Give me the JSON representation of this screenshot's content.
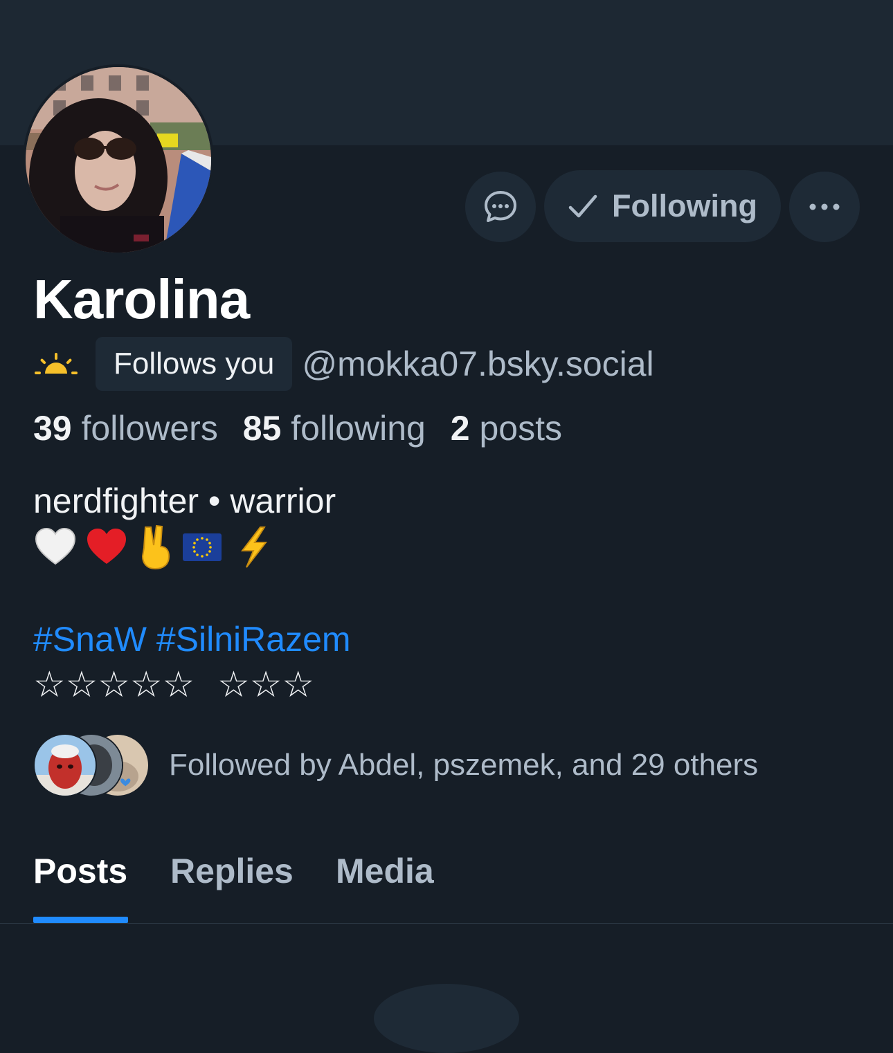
{
  "profile": {
    "display_name": "Karolina",
    "follows_you_label": "Follows you",
    "handle": "@mokka07.bsky.social",
    "stats": {
      "followers_count": "39",
      "followers_label": "followers",
      "following_count": "85",
      "following_label": "following",
      "posts_count": "2",
      "posts_label": "posts"
    },
    "bio": {
      "line1": "nerdfighter • warrior",
      "emoji_line": [
        "white-heart",
        "red-heart",
        "victory-hand",
        "eu-flag",
        "lightning"
      ],
      "hashtags": [
        "#SnaW",
        "#SilniRazem"
      ],
      "stars_line": "☆☆☆☆☆  ☆☆☆"
    },
    "known_followers_text": "Followed by Abdel, pszemek, and 29 others"
  },
  "actions": {
    "message_icon": "chat-bubble-icon",
    "following_label": "Following",
    "following_icon": "checkmark-icon",
    "more_icon": "ellipsis-icon"
  },
  "tabs": [
    {
      "label": "Posts",
      "active": true
    },
    {
      "label": "Replies",
      "active": false
    },
    {
      "label": "Media",
      "active": false
    }
  ],
  "colors": {
    "background": "#161e27",
    "banner": "#1d2833",
    "button_bg": "#1e2a36",
    "accent": "#208bfe",
    "muted_text": "#aebbc9"
  }
}
